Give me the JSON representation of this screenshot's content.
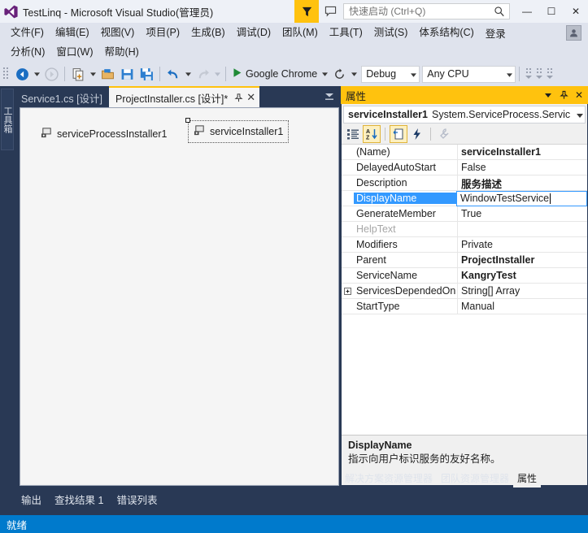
{
  "titlebar": {
    "app_title": "TestLinq - Microsoft Visual Studio(管理员)",
    "logo_icon": "visual-studio-logo",
    "feedback_icon": "feedback-funnel-icon",
    "speech_icon": "speech-bubble-icon",
    "quick_launch_placeholder": "快速启动 (Ctrl+Q)",
    "quick_launch_value": "",
    "search_icon": "search-magnifier-icon",
    "minimize_label": "—",
    "maximize_label": "☐",
    "close_label": "✕"
  },
  "menubar": {
    "row1": [
      {
        "label": "文件(F)"
      },
      {
        "label": "编辑(E)"
      },
      {
        "label": "视图(V)"
      },
      {
        "label": "项目(P)"
      },
      {
        "label": "生成(B)"
      },
      {
        "label": "调试(D)"
      },
      {
        "label": "团队(M)"
      },
      {
        "label": "工具(T)"
      },
      {
        "label": "测试(S)"
      },
      {
        "label": "体系结构(C)"
      }
    ],
    "signin_label": "登录",
    "account_icon": "user-account-icon",
    "row2": [
      {
        "label": "分析(N)"
      },
      {
        "label": "窗口(W)"
      },
      {
        "label": "帮助(H)"
      }
    ]
  },
  "toolbar": {
    "grip_icon": "toolbar-grip-handle",
    "nav_back_icon": "navigate-backward-icon",
    "nav_back_caret_icon": "chevron-down-icon",
    "nav_forward_icon": "navigate-forward-icon",
    "new_project_icon": "new-project-icon",
    "new_project_caret_icon": "chevron-down-icon",
    "open_file_icon": "open-file-icon",
    "save_icon": "save-icon",
    "save_all_icon": "save-all-icon",
    "undo_icon": "undo-arrow-icon",
    "undo_caret_icon": "chevron-down-icon",
    "redo_icon": "redo-arrow-icon",
    "redo_caret_icon": "chevron-down-icon",
    "run_icon": "play-start-icon",
    "run_label": "Google Chrome",
    "run_caret_icon": "chevron-down-icon",
    "refresh_icon": "refresh-circular-icon",
    "refresh_caret_icon": "chevron-down-icon",
    "config_value": "Debug",
    "config_caret_icon": "chevron-down-icon",
    "platform_value": "Any CPU",
    "platform_caret_icon": "chevron-down-icon",
    "overflow_icon": "toolbar-overflow-icon"
  },
  "toolbox": {
    "tab_label": "工具箱"
  },
  "document_tabs": {
    "items": [
      {
        "label": "Service1.cs [设计]",
        "active": false
      },
      {
        "label": "ProjectInstaller.cs [设计]*",
        "active": true
      }
    ],
    "pin_icon": "pin-tab-icon",
    "close_icon": "✕",
    "overflow_icon": "tab-overflow-chevron-icon"
  },
  "designer": {
    "components": [
      {
        "name": "serviceProcessInstaller1",
        "icon": "component-tray-icon",
        "selected": false
      },
      {
        "name": "serviceInstaller1",
        "icon": "component-tray-icon",
        "selected": true
      }
    ]
  },
  "bottom_tabs": {
    "items": [
      {
        "label": "输出"
      },
      {
        "label": "查找结果 1"
      },
      {
        "label": "错误列表"
      }
    ]
  },
  "properties": {
    "panel_title": "属性",
    "dropdown_icon": "chevron-down-icon",
    "pin_icon": "pin-window-icon",
    "close_icon": "✕",
    "object_name": "serviceInstaller1",
    "object_type": "System.ServiceProcess.Servic",
    "object_caret_icon": "chevron-down-icon",
    "toolbar": [
      {
        "icon": "categorized-view-icon",
        "active": false
      },
      {
        "icon": "alphabetical-sort-icon",
        "active": true
      },
      {
        "icon": "properties-page-icon",
        "active": true
      },
      {
        "icon": "events-lightning-icon",
        "active": false
      },
      {
        "icon": "property-pages-wrench-icon",
        "active": false,
        "disabled": true
      }
    ],
    "rows": [
      {
        "name": "(Name)",
        "value": "serviceInstaller1",
        "bold": true,
        "dim": false,
        "expander": false,
        "selected": false,
        "editing": false
      },
      {
        "name": "DelayedAutoStart",
        "value": "False",
        "bold": false,
        "dim": false,
        "expander": false,
        "selected": false,
        "editing": false
      },
      {
        "name": "Description",
        "value": "服务描述",
        "bold": true,
        "dim": false,
        "expander": false,
        "selected": false,
        "editing": false
      },
      {
        "name": "DisplayName",
        "value": "WindowTestService",
        "bold": false,
        "dim": false,
        "expander": false,
        "selected": true,
        "editing": true
      },
      {
        "name": "GenerateMember",
        "value": "True",
        "bold": false,
        "dim": false,
        "expander": false,
        "selected": false,
        "editing": false
      },
      {
        "name": "HelpText",
        "value": "",
        "bold": false,
        "dim": true,
        "expander": false,
        "selected": false,
        "editing": false
      },
      {
        "name": "Modifiers",
        "value": "Private",
        "bold": false,
        "dim": false,
        "expander": false,
        "selected": false,
        "editing": false
      },
      {
        "name": "Parent",
        "value": "ProjectInstaller",
        "bold": true,
        "dim": false,
        "expander": false,
        "selected": false,
        "editing": false
      },
      {
        "name": "ServiceName",
        "value": "KangryTest",
        "bold": true,
        "dim": false,
        "expander": false,
        "selected": false,
        "editing": false
      },
      {
        "name": "ServicesDependedOn",
        "value": "String[] Array",
        "bold": false,
        "dim": false,
        "expander": true,
        "selected": false,
        "editing": false
      },
      {
        "name": "StartType",
        "value": "Manual",
        "bold": false,
        "dim": false,
        "expander": false,
        "selected": false,
        "editing": false
      }
    ],
    "description": {
      "title": "DisplayName",
      "text": "指示向用户标识服务的友好名称。"
    },
    "bottom_tabs": [
      {
        "label": "解决方案资源管理器",
        "active": false
      },
      {
        "label": "团队资源管理器",
        "active": false
      },
      {
        "label": "属性",
        "active": true
      }
    ]
  },
  "statusbar": {
    "text": "就绪"
  },
  "colors": {
    "accent_yellow": "#ffc20e",
    "status_blue": "#007acc",
    "chrome_dark": "#293955",
    "selection_blue": "#3399ff"
  }
}
